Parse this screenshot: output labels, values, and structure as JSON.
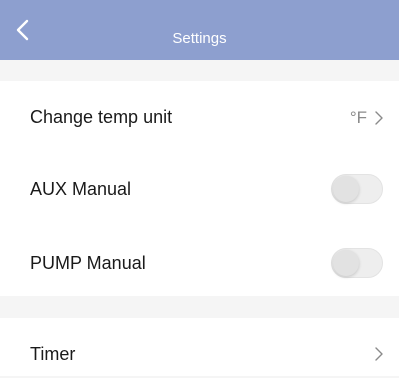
{
  "header": {
    "title": "Settings",
    "back_icon": "chevron-left-icon"
  },
  "settings": {
    "temp_unit": {
      "label": "Change temp unit",
      "value": "°F",
      "chevron_icon": "chevron-right-icon"
    },
    "aux_manual": {
      "label": "AUX Manual",
      "enabled": false
    },
    "pump_manual": {
      "label": "PUMP Manual",
      "enabled": false
    },
    "timer": {
      "label": "Timer",
      "chevron_icon": "chevron-right-icon"
    }
  },
  "colors": {
    "header_background": "#8d9fcf",
    "section_gap": "#f5f5f5",
    "toggle_off": "#eeeeee"
  }
}
